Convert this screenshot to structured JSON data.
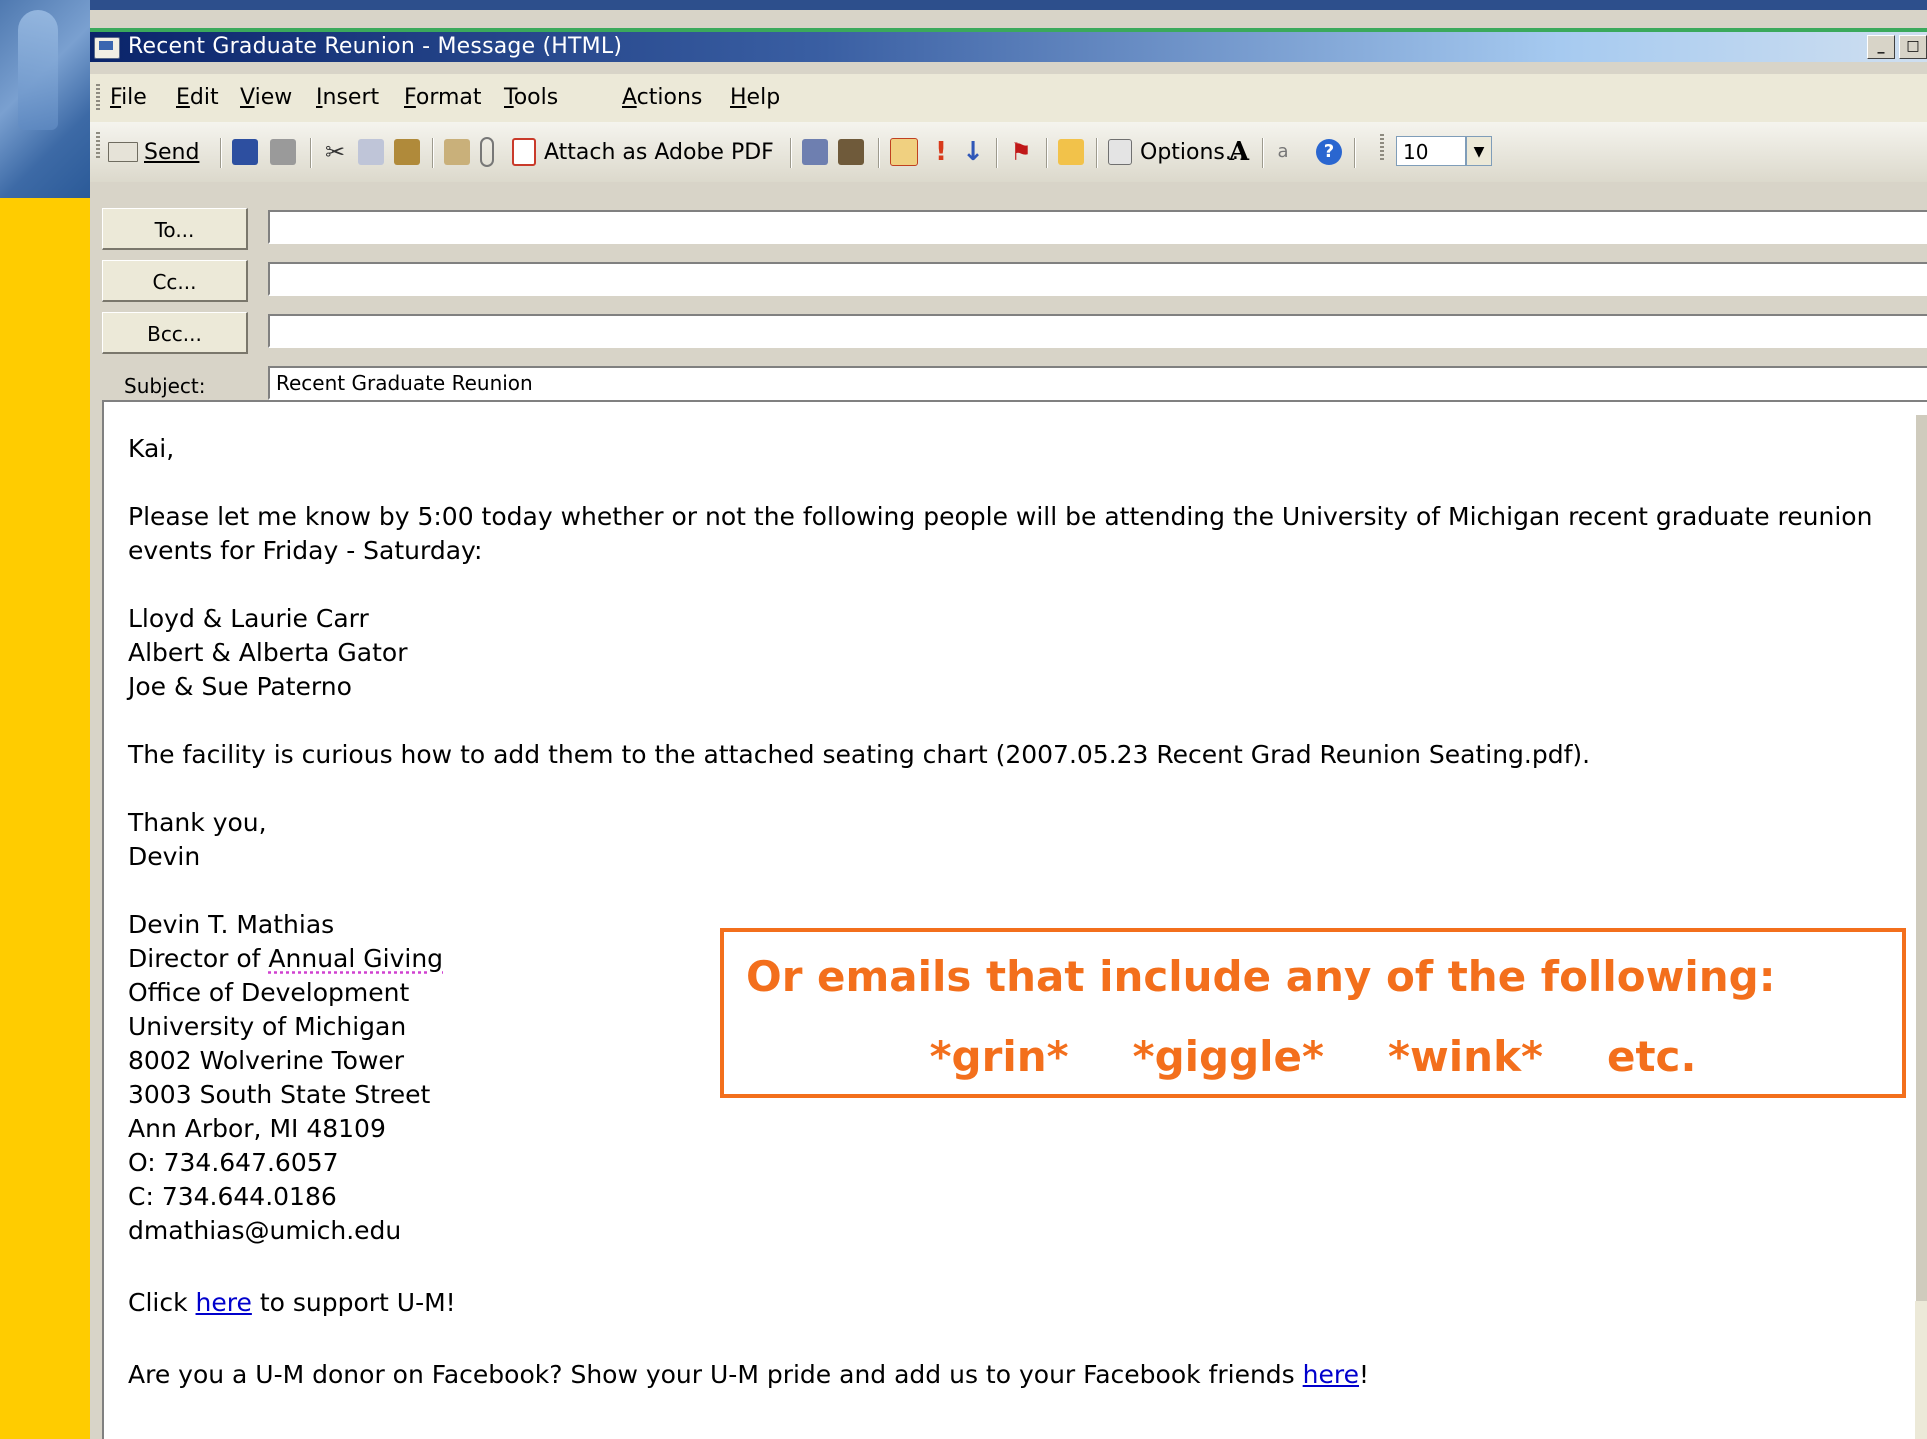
{
  "window": {
    "title": "Recent Graduate Reunion - Message (HTML)",
    "controls": [
      "_",
      "□"
    ]
  },
  "menubar": {
    "items": [
      "File",
      "Edit",
      "View",
      "Insert",
      "Format",
      "Tools",
      "Actions",
      "Help"
    ]
  },
  "toolbar": {
    "send_label": "Send",
    "attach_pdf_label": "Attach as Adobe PDF",
    "options_label": "Options...",
    "font_size": "10",
    "icons": [
      "send-icon",
      "save-icon",
      "print-icon",
      "cut-icon",
      "copy-icon",
      "paste-icon",
      "edit-icon",
      "paperclip-icon",
      "pdf-icon",
      "address-book-icon",
      "check-names-icon",
      "mail-icon",
      "high-importance-icon",
      "low-importance-icon",
      "flag-icon",
      "folder-icon",
      "options-icon",
      "font-icon",
      "encoding-icon",
      "help-icon"
    ]
  },
  "header": {
    "to_label": "To...",
    "cc_label": "Cc...",
    "bcc_label": "Bcc...",
    "subject_label": "Subject:",
    "to_value": "",
    "cc_value": "",
    "bcc_value": "",
    "subject_value": "Recent Graduate Reunion"
  },
  "message": {
    "greeting": "Kai,",
    "para1": "Please let me know by 5:00 today whether or not the following people will be attending the University of Michigan recent graduate reunion events for Friday - Saturday:",
    "names": [
      "Lloyd & Laurie Carr",
      "Albert & Alberta Gator",
      "Joe & Sue Paterno"
    ],
    "para2": "The facility is curious how to add them to the attached seating chart (2007.05.23 Recent Grad Reunion Seating.pdf).",
    "closing": "Thank you,",
    "closing_name": "Devin",
    "signature": {
      "name": "Devin T. Mathias",
      "title_prefix": "Director of ",
      "title_underlined": "Annual Giving",
      "office": "Office of Development",
      "university": "University of Michigan",
      "room": "8002 Wolverine Tower",
      "street": "3003 South State Street",
      "city": "Ann Arbor, MI 48109",
      "office_phone": "O: 734.647.6057",
      "cell_phone": "C: 734.644.0186",
      "email": "dmathias@umich.edu"
    },
    "support_pre": "Click ",
    "support_link": "here",
    "support_post": " to support U-M!",
    "facebook_pre": "Are you a U-M donor on Facebook?  Show your U-M pride and add us to your Facebook friends ",
    "facebook_link": "here",
    "facebook_post": "!"
  },
  "callout": {
    "line1": "Or emails that include any of the following:",
    "terms": [
      "*grin*",
      "*giggle*",
      "*wink*",
      "etc."
    ],
    "color": "#f36f1c"
  }
}
